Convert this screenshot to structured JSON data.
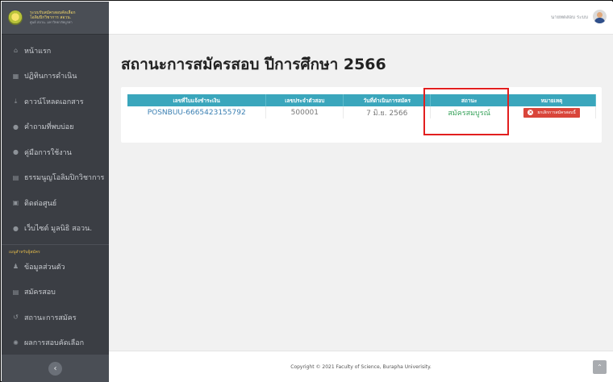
{
  "brand": {
    "line1": "ระบบรับสมัครสอบคัดเลือก",
    "line2": "โอลิมปิกวิชาการ สอวน.",
    "line3": "ศูนย์ สอวน. มหาวิทยาลัยบูรพา"
  },
  "sidebar": {
    "items": [
      {
        "label": "หน้าแรก",
        "icon": "home-icon"
      },
      {
        "label": "ปฏิทินการดำเนิน",
        "icon": "calendar-icon"
      },
      {
        "label": "ดาวน์โหลดเอกสาร",
        "icon": "download-icon"
      },
      {
        "label": "คำถามที่พบบ่อย",
        "icon": "question-icon"
      },
      {
        "label": "คู่มือการใช้งาน",
        "icon": "manual-icon"
      },
      {
        "label": "ธรรมนูญโอลิมปิกวิชาการ",
        "icon": "document-icon"
      },
      {
        "label": "ติดต่อศูนย์",
        "icon": "contact-icon"
      },
      {
        "label": "เว็บไซต์ มูลนิธิ สอวน.",
        "icon": "globe-icon"
      }
    ],
    "section_label": "เมนูสำหรับผู้สมัคร",
    "member_items": [
      {
        "label": "ข้อมูลส่วนตัว",
        "icon": "user-icon"
      },
      {
        "label": "สมัครสอบ",
        "icon": "form-icon"
      },
      {
        "label": "สถานะการสมัคร",
        "icon": "history-icon"
      },
      {
        "label": "ผลการสอบคัดเลือก",
        "icon": "result-icon"
      }
    ],
    "collapse_icon": "‹"
  },
  "topbar": {
    "user_name": "นายทดสอบ ระบบ"
  },
  "main": {
    "title": "สถานะการสมัครสอบ ปีการศึกษา 2566",
    "table": {
      "headers": [
        "เลขที่ใบแจ้งชำระเงิน",
        "เลขประจำตัวสอบ",
        "วันที่ดำเนินการสมัคร",
        "สถานะ",
        "หมายเหตุ"
      ],
      "rows": [
        {
          "payment_no": "POSNBUU-6665423155792",
          "exam_id": "500001",
          "date": "7 มิ.ย. 2566",
          "status": "สมัครสมบูรณ์",
          "action": "ยกเลิกการสมัครสอบนี้"
        }
      ]
    }
  },
  "footer": {
    "copyright": "Copyright © 2021 Faculty of Science, Burapha Univerisity.",
    "scroll_top": "⌃"
  },
  "colors": {
    "sidebar_bg": "#3b3e44",
    "table_header": "#3aa6bc",
    "status_green": "#37a25a",
    "cancel_red": "#d9453a",
    "highlight_red": "#e21f1f"
  }
}
